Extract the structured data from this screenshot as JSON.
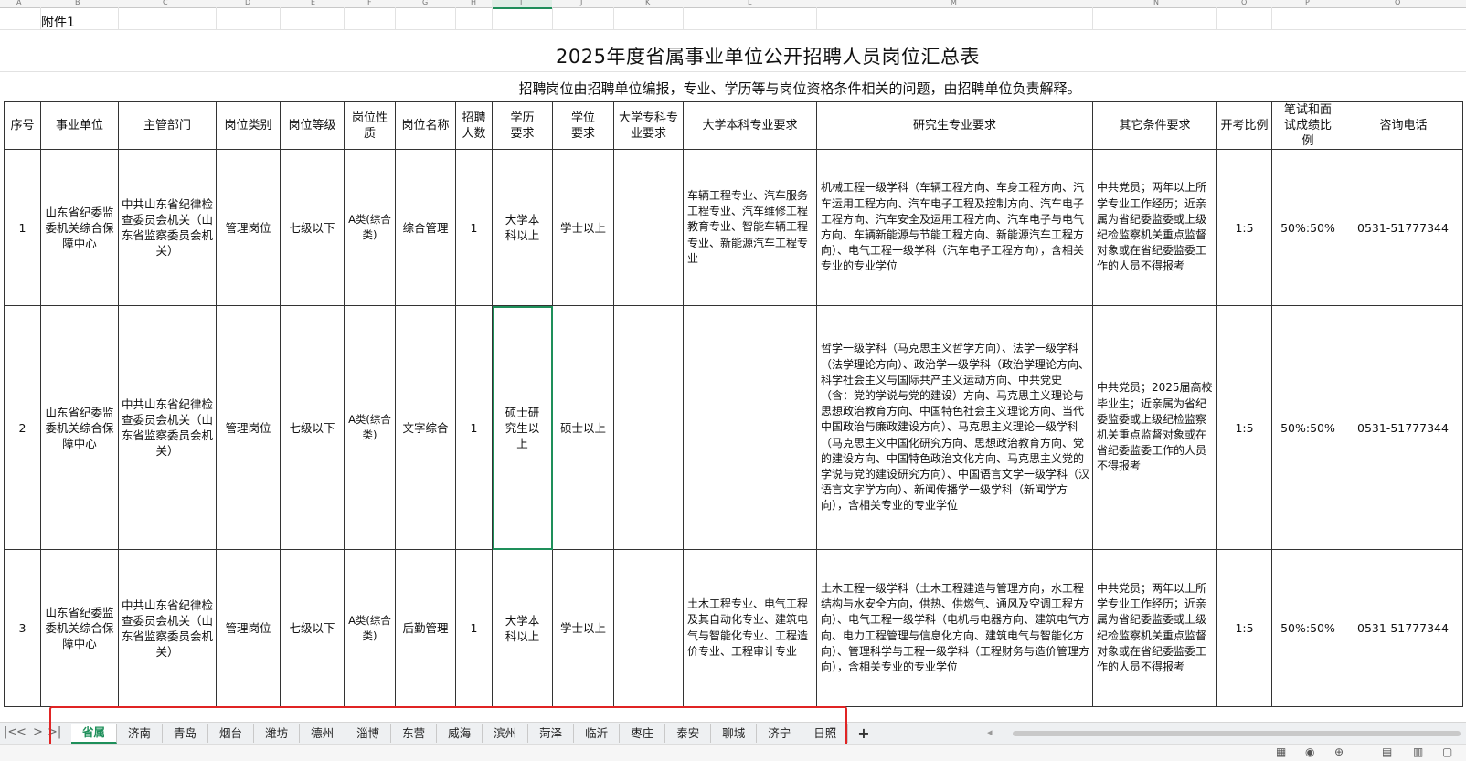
{
  "sheet": {
    "attachment_label": "附件1",
    "title": "2025年度省属事业单位公开招聘人员岗位汇总表",
    "subtitle": "招聘岗位由招聘单位编报，专业、学历等与岗位资格条件相关的问题，由招聘单位负责解释。",
    "column_letters": [
      "A",
      "B",
      "C",
      "D",
      "E",
      "F",
      "G",
      "H",
      "I",
      "J",
      "K",
      "L",
      "M",
      "N",
      "O",
      "P",
      "Q"
    ],
    "headers": {
      "seq": "序号",
      "unit": "事业单位",
      "dept": "主管部门",
      "post_type": "岗位类别",
      "post_level": "岗位等级",
      "post_nature": "岗位性质",
      "post_name": "岗位名称",
      "count": "招聘人数",
      "education": "学历要求",
      "degree": "学位要求",
      "college_major": "大学专科专业要求",
      "bachelor_major": "大学本科专业要求",
      "grad_major": "研究生专业要求",
      "other": "其它条件要求",
      "ratio": "开考比例",
      "exam_ratio": "笔试和面试成绩比例",
      "phone": "咨询电话"
    },
    "rows": [
      {
        "seq": "1",
        "unit": "山东省纪委监委机关综合保障中心",
        "dept": "中共山东省纪律检查委员会机关（山东省监察委员会机关）",
        "post_type": "管理岗位",
        "post_level": "七级以下",
        "post_nature": "A类(综合类)",
        "post_name": "综合管理",
        "count": "1",
        "education": "大学本科以上",
        "degree": "学士以上",
        "college_major": "",
        "bachelor_major": "车辆工程专业、汽车服务工程专业、汽车维修工程教育专业、智能车辆工程专业、新能源汽车工程专业",
        "grad_major": "机械工程一级学科（车辆工程方向、车身工程方向、汽车运用工程方向、汽车电子工程及控制方向、汽车电子工程方向、汽车安全及运用工程方向、汽车电子与电气方向、车辆新能源与节能工程方向、新能源汽车工程方向）、电气工程一级学科（汽车电子工程方向），含相关专业的专业学位",
        "other": "中共党员；两年以上所学专业工作经历；近亲属为省纪委监委或上级纪检监察机关重点监督对象或在省纪委监委工作的人员不得报考",
        "ratio": "1:5",
        "exam_ratio": "50%:50%",
        "phone": "0531-51777344"
      },
      {
        "seq": "2",
        "unit": "山东省纪委监委机关综合保障中心",
        "dept": "中共山东省纪律检查委员会机关（山东省监察委员会机关）",
        "post_type": "管理岗位",
        "post_level": "七级以下",
        "post_nature": "A类(综合类)",
        "post_name": "文字综合",
        "count": "1",
        "education": "硕士研究生以上",
        "degree": "硕士以上",
        "college_major": "",
        "bachelor_major": "",
        "grad_major": "哲学一级学科（马克思主义哲学方向）、法学一级学科（法学理论方向）、政治学一级学科（政治学理论方向、科学社会主义与国际共产主义运动方向、中共党史（含：党的学说与党的建设）方向、马克思主义理论与思想政治教育方向、中国特色社会主义理论方向、当代中国政治与廉政建设方向）、马克思主义理论一级学科（马克思主义中国化研究方向、思想政治教育方向、党的建设方向、中国特色政治文化方向、马克思主义党的学说与党的建设研究方向）、中国语言文学一级学科（汉语言文字学方向）、新闻传播学一级学科（新闻学方向），含相关专业的专业学位",
        "other": "中共党员；2025届高校毕业生；近亲属为省纪委监委或上级纪检监察机关重点监督对象或在省纪委监委工作的人员不得报考",
        "ratio": "1:5",
        "exam_ratio": "50%:50%",
        "phone": "0531-51777344"
      },
      {
        "seq": "3",
        "unit": "山东省纪委监委机关综合保障中心",
        "dept": "中共山东省纪律检查委员会机关（山东省监察委员会机关）",
        "post_type": "管理岗位",
        "post_level": "七级以下",
        "post_nature": "A类(综合类)",
        "post_name": "后勤管理",
        "count": "1",
        "education": "大学本科以上",
        "degree": "学士以上",
        "college_major": "",
        "bachelor_major": "土木工程专业、电气工程及其自动化专业、建筑电气与智能化专业、工程造价专业、工程审计专业",
        "grad_major": "土木工程一级学科（土木工程建造与管理方向，水工程结构与水安全方向，供热、供燃气、通风及空调工程方向）、电气工程一级学科（电机与电器方向、建筑电气方向、电力工程管理与信息化方向、建筑电气与智能化方向）、管理科学与工程一级学科（工程财务与造价管理方向），含相关专业的专业学位",
        "other": "中共党员；两年以上所学专业工作经历；近亲属为省纪委监委或上级纪检监察机关重点监督对象或在省纪委监委工作的人员不得报考",
        "ratio": "1:5",
        "exam_ratio": "50%:50%",
        "phone": "0531-51777344"
      }
    ]
  },
  "tabs": {
    "items": [
      "省属",
      "济南",
      "青岛",
      "烟台",
      "潍坊",
      "德州",
      "淄博",
      "东营",
      "威海",
      "滨州",
      "菏泽",
      "临沂",
      "枣庄",
      "泰安",
      "聊城",
      "济宁",
      "日照"
    ],
    "active": "省属",
    "add_label": "+"
  },
  "nav": {
    "first": "|<",
    "prev": "<",
    "next": ">",
    "last": ">|"
  },
  "colors": {
    "accent": "#1e8f5a",
    "highlight_box": "#e02424"
  }
}
